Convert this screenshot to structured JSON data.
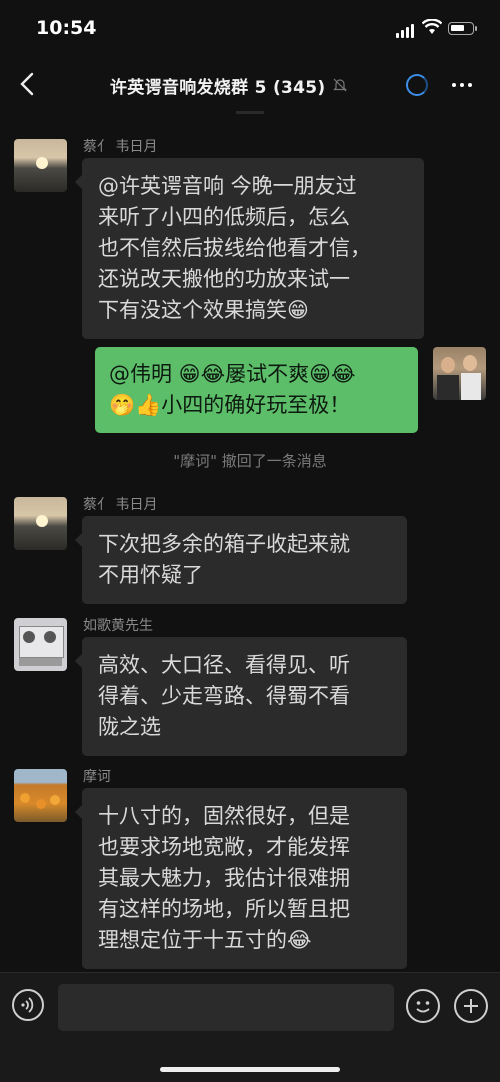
{
  "status": {
    "time": "10:54",
    "battery_level": 0.7
  },
  "nav": {
    "title": "许英谔音响发烧群 5 (345)"
  },
  "colors": {
    "background": "#111111",
    "bubble_other": "#2b2b2b",
    "bubble_mine": "#5dbe6a",
    "accent": "#3b8fe8"
  },
  "messages": [
    {
      "sender": "蔡亻 韦日月",
      "lines": [
        "@许英谔音响 今晚一朋友过",
        "来听了小四的低频后，怎么",
        "也不信然后拔线给他看才信，",
        "还说改天搬他的功放来试一",
        "下有没这个效果搞笑😁"
      ]
    },
    {
      "lines": [
        "@伟明 😁😂屡试不爽😁😂",
        "🤭👍小四的确好玩至极！"
      ]
    },
    {
      "sender": "蔡亻 韦日月",
      "lines": [
        "下次把多余的箱子收起来就",
        "不用怀疑了"
      ]
    },
    {
      "sender": "如歌黄先生",
      "lines": [
        "高效、大口径、看得见、听",
        "得着、少走弯路、得蜀不看",
        "陇之选"
      ]
    },
    {
      "sender": "摩诃",
      "lines": [
        "十八寸的，固然很好，但是",
        "也要求场地宽敞，才能发挥",
        "其最大魅力，我估计很难拥",
        "有这样的场地，所以暂且把",
        "理想定位于十五寸的😂"
      ]
    }
  ],
  "recall_notice": "\"摩诃\" 撤回了一条消息",
  "input": {
    "placeholder": ""
  }
}
